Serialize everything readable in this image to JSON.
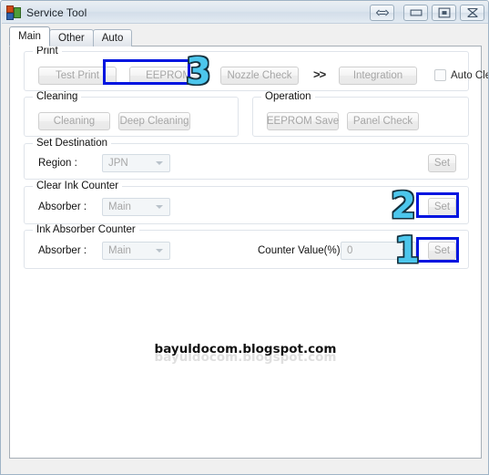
{
  "window": {
    "title": "Service Tool",
    "icon": "printer-app-icon",
    "buttons": [
      {
        "name": "resize-arrows-button",
        "icon": "double-arrow-horizontal-icon"
      },
      {
        "name": "minimize-button",
        "icon": "minimize-icon"
      },
      {
        "name": "maximize-button",
        "icon": "maximize-icon"
      },
      {
        "name": "close-button",
        "icon": "close-icon"
      }
    ]
  },
  "tabs": [
    {
      "label": "Main",
      "active": true
    },
    {
      "label": "Other",
      "active": false
    },
    {
      "label": "Auto",
      "active": false
    }
  ],
  "groups": {
    "print": {
      "title": "Print",
      "test_print": "Test Print",
      "eeprom": "EEPROM",
      "nozzle_check": "Nozzle Check",
      "chevrons": ">>",
      "integration": "Integration",
      "auto_cleaning": "Auto Cleaning",
      "auto_cleaning_checked": false
    },
    "cleaning": {
      "title": "Cleaning",
      "cleaning": "Cleaning",
      "deep_cleaning": "Deep Cleaning"
    },
    "operation": {
      "title": "Operation",
      "eeprom_save": "EEPROM Save",
      "panel_check": "Panel Check"
    },
    "set_destination": {
      "title": "Set Destination",
      "region_label": "Region :",
      "region_value": "JPN",
      "set": "Set"
    },
    "clear_ink_counter": {
      "title": "Clear Ink Counter",
      "absorber_label": "Absorber :",
      "absorber_value": "Main",
      "set": "Set"
    },
    "ink_absorber_counter": {
      "title": "Ink Absorber Counter",
      "absorber_label": "Absorber :",
      "absorber_value": "Main",
      "counter_value_label": "Counter Value(%) :",
      "counter_value": "0",
      "set": "Set"
    }
  },
  "annotations": {
    "step1": "1",
    "step2": "2",
    "step3": "3",
    "highlight_color": "#0015e0",
    "number_fill_color": "#4cc6ec",
    "number_outline_color": "#14303d"
  },
  "watermark": {
    "text": "bayuldocom.blogspot.com"
  }
}
